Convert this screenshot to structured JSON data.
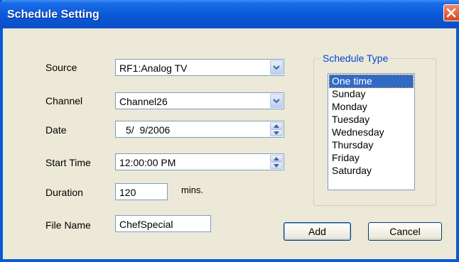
{
  "window": {
    "title": "Schedule Setting"
  },
  "form": {
    "source": {
      "label": "Source",
      "value": "RF1:Analog TV"
    },
    "channel": {
      "label": "Channel",
      "value": "Channel26"
    },
    "date": {
      "label": "Date",
      "value": "5/  9/2006"
    },
    "start_time": {
      "label": "Start Time",
      "value": "12:00:00 PM"
    },
    "duration": {
      "label": "Duration",
      "value": "120",
      "unit": "mins."
    },
    "file_name": {
      "label": "File Name",
      "value": "ChefSpecial"
    }
  },
  "schedule_type": {
    "label": "Schedule Type",
    "items": [
      "One time",
      "Sunday",
      "Monday",
      "Tuesday",
      "Wednesday",
      "Thursday",
      "Friday",
      "Saturday"
    ],
    "selected": "One time"
  },
  "buttons": {
    "add": "Add",
    "cancel": "Cancel"
  },
  "colors": {
    "titlebar": "#0a58d8",
    "selection": "#316ac5",
    "group_legend": "#0046d5",
    "dialog_bg": "#ece9d8"
  },
  "icons": {
    "close": "close-icon",
    "dropdown": "chevron-down-icon",
    "spin": "spin-arrows-icon"
  }
}
